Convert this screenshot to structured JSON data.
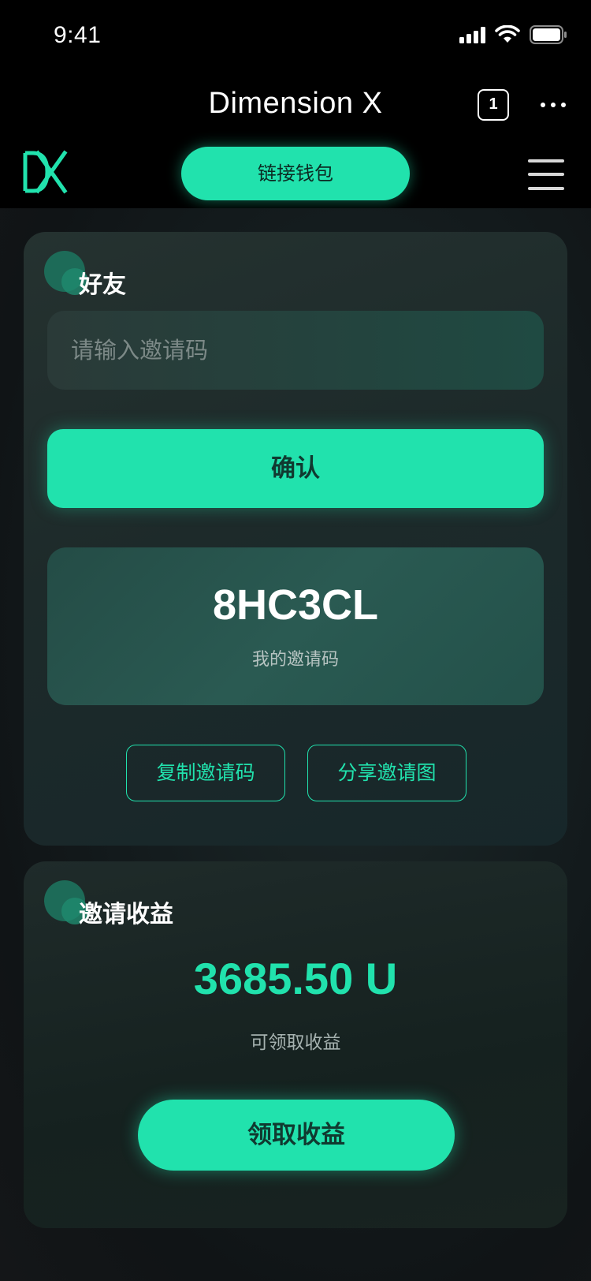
{
  "status_bar": {
    "time": "9:41"
  },
  "browser_nav": {
    "title": "Dimension X",
    "tab_count": "1"
  },
  "header": {
    "connect_wallet_label": "链接钱包"
  },
  "friends_card": {
    "title": "好友",
    "invite_input_placeholder": "请输入邀请码",
    "invite_input_value": "",
    "confirm_label": "确认",
    "my_code": "8HC3CL",
    "my_code_label": "我的邀请码",
    "copy_label": "复制邀请码",
    "share_label": "分享邀请图"
  },
  "earnings_card": {
    "title": "邀请收益",
    "amount": "3685.50 U",
    "amount_label": "可领取收益",
    "claim_label": "领取收益"
  },
  "colors": {
    "accent": "#21e2ad",
    "background": "#000000",
    "card": "#1d2a2a"
  },
  "icons": [
    "signal-icon",
    "wifi-icon",
    "battery-icon",
    "tabs-icon",
    "more-icon",
    "logo-icon",
    "menu-icon"
  ]
}
